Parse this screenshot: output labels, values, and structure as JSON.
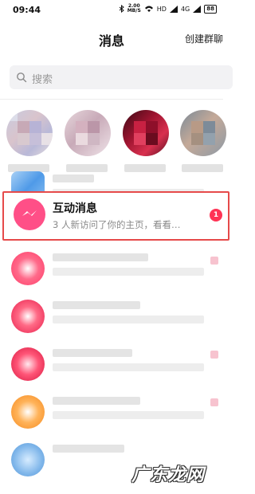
{
  "status_bar": {
    "time": "09:44",
    "net_speed_value": "2.00",
    "net_speed_unit": "MB/S",
    "signal_1": "4G",
    "signal_2": "HD",
    "battery": "88"
  },
  "header": {
    "title": "消息",
    "create_group": "创建群聊"
  },
  "search": {
    "placeholder": "搜索"
  },
  "interaction_row": {
    "title": "互动消息",
    "subtitle": "3 人新访问了你的主页，看看…",
    "badge": "1"
  },
  "watermark": "广东龙网",
  "colors": {
    "highlight_border": "#e64a4a",
    "interaction_avatar": "#ff4f87",
    "badge": "#ff3355"
  }
}
